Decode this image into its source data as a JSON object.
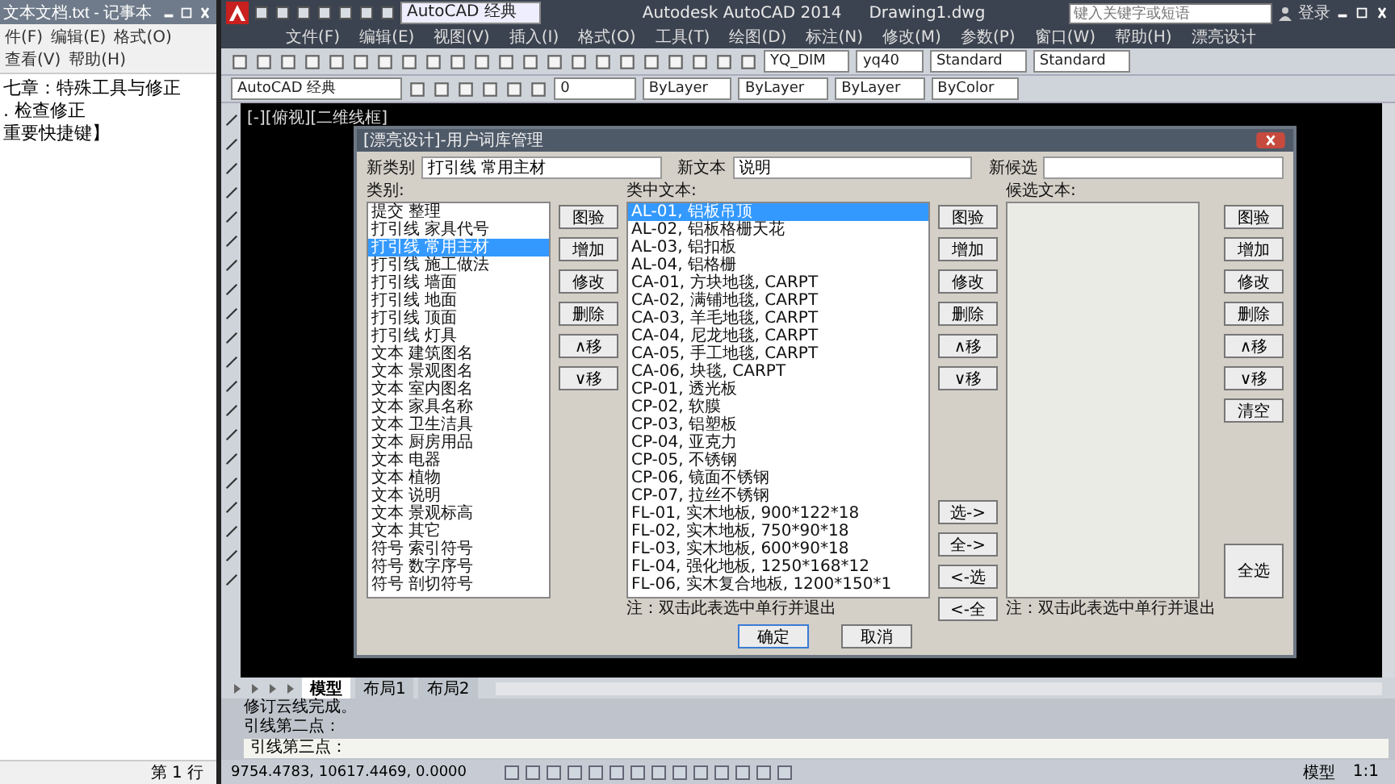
{
  "notepad": {
    "title": "文本文档.txt - 记事本",
    "menu": [
      "件(F)",
      "编辑(E)",
      "格式(O)",
      "查看(V)",
      "帮助(H)"
    ],
    "lines": [
      "七章：特殊工具与修正",
      ". 检查修正",
      "重要快捷键】"
    ],
    "status": "第 1 行"
  },
  "cad": {
    "app_title": "Autodesk AutoCAD 2014",
    "file_title": "Drawing1.dwg",
    "workspace": "AutoCAD 经典",
    "search": {
      "placeholder": "键入关键字或短语"
    },
    "login": "登录",
    "menu": [
      "文件(F)",
      "编辑(E)",
      "视图(V)",
      "插入(I)",
      "格式(O)",
      "工具(T)",
      "绘图(D)",
      "标注(N)",
      "修改(M)",
      "参数(P)",
      "窗口(W)",
      "帮助(H)",
      "漂亮设计"
    ],
    "styles": [
      "YQ_DIM",
      "yq40",
      "Standard",
      "Standard"
    ],
    "properties": {
      "workspace": "AutoCAD 经典",
      "layer": "0",
      "fill_color": "ByLayer",
      "linetype": "ByLayer",
      "lineweight": "ByLayer",
      "plotstyle": "ByColor"
    },
    "viewport_label": "[-][俯视][二维线框]",
    "dialog": {
      "title": "[漂亮设计]-用户词库管理",
      "fields": [
        {
          "label": "新类别",
          "value": "打引线 常用主材"
        },
        {
          "label": "新文本",
          "value": "说明"
        },
        {
          "label": "新候选"
        }
      ],
      "category_label": "类别:",
      "categories": [
        {
          "label": "提交 整理",
          "selected": false
        },
        {
          "label": "打引线 家具代号",
          "selected": false
        },
        {
          "label": "打引线 常用主材",
          "selected": true
        },
        {
          "label": "打引线 施工做法",
          "selected": false
        },
        {
          "label": "打引线 墙面",
          "selected": false
        },
        {
          "label": "打引线 地面",
          "selected": false
        },
        {
          "label": "打引线 顶面",
          "selected": false
        },
        {
          "label": "打引线 灯具",
          "selected": false
        },
        {
          "label": "文本 建筑图名",
          "selected": false
        },
        {
          "label": "文本 景观图名",
          "selected": false
        },
        {
          "label": "文本 室内图名",
          "selected": false
        },
        {
          "label": "文本 家具名称",
          "selected": false
        },
        {
          "label": "文本 卫生洁具",
          "selected": false
        },
        {
          "label": "文本 厨房用品",
          "selected": false
        },
        {
          "label": "文本 电器",
          "selected": false
        },
        {
          "label": "文本 植物",
          "selected": false
        },
        {
          "label": "文本 说明",
          "selected": false
        },
        {
          "label": "文本 景观标高",
          "selected": false
        },
        {
          "label": "文本 其它",
          "selected": false
        },
        {
          "label": "符号 索引符号",
          "selected": false
        },
        {
          "label": "符号 数字序号",
          "selected": false
        },
        {
          "label": "符号 剖切符号",
          "selected": false
        }
      ],
      "text_label": "类中文本:",
      "texts": [
        {
          "label": "AL-01, 铝板吊顶",
          "selected": true
        },
        {
          "label": "AL-02, 铝板格栅天花",
          "selected": false
        },
        {
          "label": "AL-03, 铝扣板",
          "selected": false
        },
        {
          "label": "AL-04, 铝格栅",
          "selected": false
        },
        {
          "label": "CA-01, 方块地毯, CARPT",
          "selected": false
        },
        {
          "label": "CA-02, 满铺地毯, CARPT",
          "selected": false
        },
        {
          "label": "CA-03, 羊毛地毯, CARPT",
          "selected": false
        },
        {
          "label": "CA-04, 尼龙地毯, CARPT",
          "selected": false
        },
        {
          "label": "CA-05, 手工地毯, CARPT",
          "selected": false
        },
        {
          "label": "CA-06, 块毯, CARPT",
          "selected": false
        },
        {
          "label": "CP-01, 透光板",
          "selected": false
        },
        {
          "label": "CP-02, 软膜",
          "selected": false
        },
        {
          "label": "CP-03, 铝塑板",
          "selected": false
        },
        {
          "label": "CP-04, 亚克力",
          "selected": false
        },
        {
          "label": "CP-05, 不锈钢",
          "selected": false
        },
        {
          "label": "CP-06, 镜面不锈钢",
          "selected": false
        },
        {
          "label": "CP-07, 拉丝不锈钢",
          "selected": false
        },
        {
          "label": "FL-01, 实木地板, 900*122*18",
          "selected": false
        },
        {
          "label": "FL-02, 实木地板, 750*90*18",
          "selected": false
        },
        {
          "label": "FL-03, 实木地板, 600*90*18",
          "selected": false
        },
        {
          "label": "FL-04, 强化地板, 1250*168*12",
          "selected": false
        },
        {
          "label": "FL-06, 实木复合地板, 1200*150*1",
          "selected": false
        }
      ],
      "candidate_label": "候选文本:",
      "category_buttons": [
        "图验",
        "增加",
        "修改",
        "删除",
        "∧移",
        "∨移"
      ],
      "text_buttons": [
        "图验",
        "增加",
        "修改",
        "删除",
        "∧移",
        "∨移"
      ],
      "transfer_buttons": [
        "选->",
        "全->",
        "<-选",
        "<-全"
      ],
      "candidate_buttons": [
        "图验",
        "增加",
        "修改",
        "删除",
        "∧移",
        "∨移",
        "清空"
      ],
      "select_all": "全选",
      "note_left": "注：双击此表选中单行并退出",
      "note_right": "注：双击此表选中单行并退出",
      "ok": "确定",
      "cancel": "取消"
    },
    "layout_tabs": [
      {
        "label": "模型",
        "selected": true
      },
      {
        "label": "布局1",
        "selected": false
      },
      {
        "label": "布局2",
        "selected": false
      }
    ],
    "command": {
      "history": [
        "修订云线完成。",
        "引线第二点："
      ],
      "prompt": "引线第三点："
    },
    "coordinates": "9754.4783, 10617.4469, 0.0000",
    "status_right": [
      "模型",
      "1:1"
    ]
  }
}
